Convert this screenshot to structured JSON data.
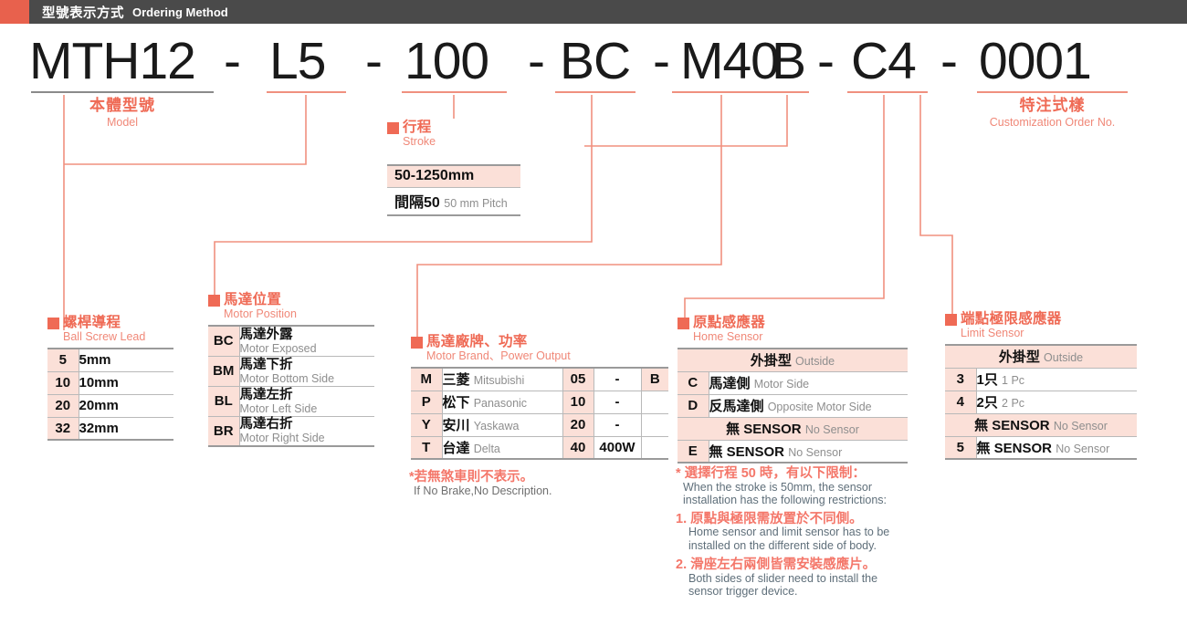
{
  "header": {
    "cn": "型號表示方式",
    "en": "Ordering Method"
  },
  "code": {
    "model": "MTH12",
    "lead": "L5",
    "stroke": "100",
    "motor_position": "BC",
    "motor_brand": "M40",
    "brake": "B",
    "home_sensor": "C4",
    "customization": "0001",
    "dash": "-"
  },
  "model_caption": {
    "cn": "本體型號",
    "en": "Model"
  },
  "custom_caption": {
    "cn": "特注式樣",
    "en": "Customization Order No."
  },
  "stroke": {
    "cn": "行程",
    "en": "Stroke",
    "range": "50-1250mm",
    "pitch_cn": "間隔50",
    "pitch_en": "50 mm Pitch"
  },
  "lead": {
    "cn": "螺桿導程",
    "en": "Ball Screw Lead",
    "rows": [
      {
        "key": "5",
        "val": "5mm"
      },
      {
        "key": "10",
        "val": "10mm"
      },
      {
        "key": "20",
        "val": "20mm"
      },
      {
        "key": "32",
        "val": "32mm"
      }
    ]
  },
  "motor_position": {
    "cn": "馬達位置",
    "en": "Motor Position",
    "rows": [
      {
        "key": "BC",
        "cn": "馬達外露",
        "en": "Motor Exposed"
      },
      {
        "key": "BM",
        "cn": "馬達下折",
        "en": "Motor Bottom Side"
      },
      {
        "key": "BL",
        "cn": "馬達左折",
        "en": "Motor Left Side"
      },
      {
        "key": "BR",
        "cn": "馬達右折",
        "en": "Motor Right Side"
      }
    ]
  },
  "motor_brand": {
    "cn": "馬達廠牌、功率",
    "en": "Motor Brand、Power Output",
    "rows": [
      {
        "key": "M",
        "cn": "三菱",
        "en": "Mitsubishi",
        "pw_key": "05",
        "pw_val": "-",
        "brake": "B"
      },
      {
        "key": "P",
        "cn": "松下",
        "en": "Panasonic",
        "pw_key": "10",
        "pw_val": "-",
        "brake": ""
      },
      {
        "key": "Y",
        "cn": "安川",
        "en": "Yaskawa",
        "pw_key": "20",
        "pw_val": "-",
        "brake": ""
      },
      {
        "key": "T",
        "cn": "台達",
        "en": "Delta",
        "pw_key": "40",
        "pw_val": "400W",
        "brake": ""
      }
    ],
    "note_cn": "*若無煞車則不表示。",
    "note_en": "If No Brake,No Description."
  },
  "home_sensor": {
    "cn": "原點感應器",
    "en": "Home Sensor",
    "banner1_cn": "外掛型",
    "banner1_en": "Outside",
    "rows": [
      {
        "key": "C",
        "cn": "馬達側",
        "en": "Motor Side"
      },
      {
        "key": "D",
        "cn": "反馬達側",
        "en": "Opposite Motor Side"
      }
    ],
    "banner2_cn": "無 SENSOR",
    "banner2_en": "No Sensor",
    "rows2": [
      {
        "key": "E",
        "cn": "無 SENSOR",
        "en": "No Sensor"
      }
    ],
    "note_head_cn": "* 選擇行程 50 時，有以下限制：",
    "note_head_en1": "When the stroke is 50mm, the sensor",
    "note_head_en2": "installation has the following restrictions:",
    "notes": [
      {
        "cn": "1. 原點與極限需放置於不同側。",
        "en1": "Home sensor and limit sensor has to be",
        "en2": "installed on the different side of body."
      },
      {
        "cn": "2. 滑座左右兩側皆需安裝感應片。",
        "en1": "Both sides of slider need to install the",
        "en2": "sensor trigger device."
      }
    ]
  },
  "limit_sensor": {
    "cn": "端點極限感應器",
    "en": "Limit Sensor",
    "banner1_cn": "外掛型",
    "banner1_en": "Outside",
    "rows": [
      {
        "key": "3",
        "cn": "1只",
        "en": "1 Pc"
      },
      {
        "key": "4",
        "cn": "2只",
        "en": "2 Pc"
      }
    ],
    "banner2_cn": "無 SENSOR",
    "banner2_en": "No Sensor",
    "rows2": [
      {
        "key": "5",
        "cn": "無 SENSOR",
        "en": "No Sensor"
      }
    ]
  },
  "colors": {
    "accent": "#ef6a55",
    "header_bar": "#4a4a4a",
    "key_bg": "#fbe0d8",
    "wire": "#f0907f"
  }
}
